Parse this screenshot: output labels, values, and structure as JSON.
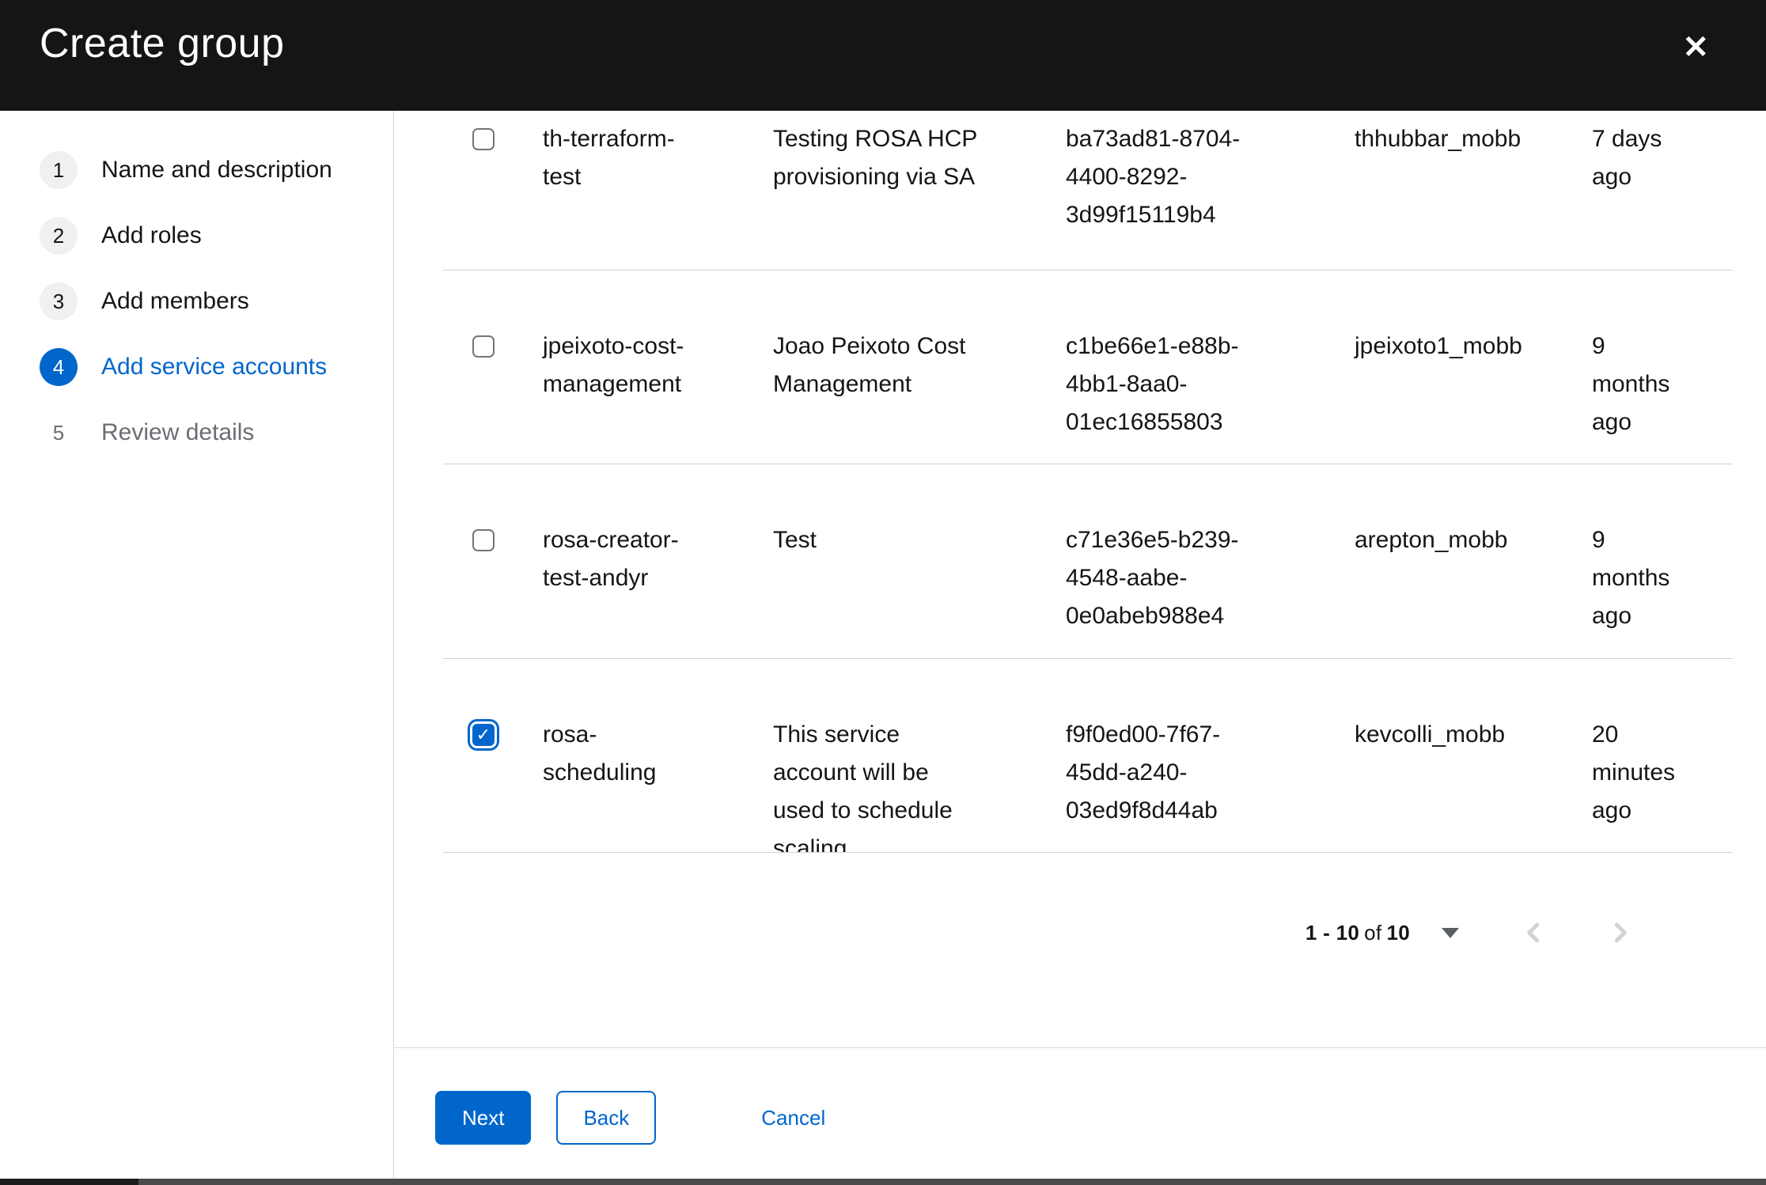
{
  "modal": {
    "title": "Create group"
  },
  "icons": {
    "close": "✕",
    "check": "✓"
  },
  "wizard": {
    "steps": [
      {
        "number": "1",
        "label": "Name and description",
        "state": "default"
      },
      {
        "number": "2",
        "label": "Add roles",
        "state": "default"
      },
      {
        "number": "3",
        "label": "Add members",
        "state": "default"
      },
      {
        "number": "4",
        "label": "Add service accounts",
        "state": "current"
      },
      {
        "number": "5",
        "label": "Review details",
        "state": "upcoming"
      }
    ]
  },
  "table": {
    "rows": [
      {
        "checked": false,
        "name": "th-terraform-test",
        "description": "Testing ROSA HCP provisioning via SA",
        "client_id": "ba73ad81-8704-4400-8292-3d99f15119b4",
        "owner": "thhubbar_mobb",
        "time_created": "7 days ago"
      },
      {
        "checked": false,
        "name": "jpeixoto-cost-management",
        "description": "Joao Peixoto Cost Management",
        "client_id": "c1be66e1-e88b-4bb1-8aa0-01ec16855803",
        "owner": "jpeixoto1_mobb",
        "time_created": "9 months ago"
      },
      {
        "checked": false,
        "name": "rosa-creator-test-andyr",
        "description": "Test",
        "client_id": "c71e36e5-b239-4548-aabe-0e0abeb988e4",
        "owner": "arepton_mobb",
        "time_created": "9 months ago"
      },
      {
        "checked": true,
        "name": "rosa-scheduling",
        "description": "This service account will be used to schedule scaling",
        "client_id": "f9f0ed00-7f67-45dd-a240-03ed9f8d44ab",
        "owner": "kevcolli_mobb",
        "time_created": "20 minutes ago"
      }
    ]
  },
  "pagination": {
    "range": "1 - 10",
    "of_label": "of",
    "total": "10"
  },
  "footer": {
    "next": "Next",
    "back": "Back",
    "cancel": "Cancel"
  },
  "colors": {
    "primary_blue": "#0066cc",
    "header_bg": "#151515",
    "text": "#151515",
    "muted": "#6a6e73",
    "separator": "#d2d2d2"
  }
}
